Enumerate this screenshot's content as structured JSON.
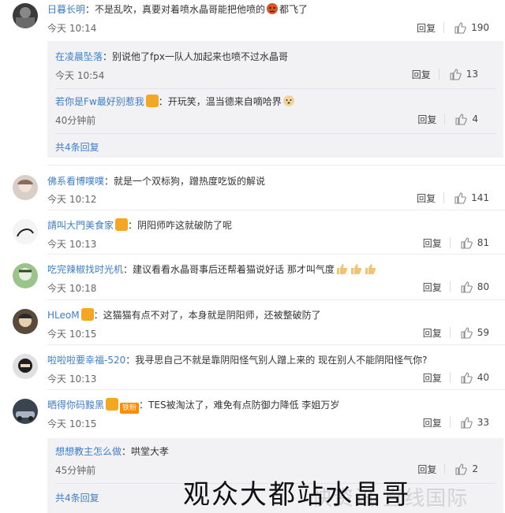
{
  "reply_label": "回复",
  "comments": [
    {
      "name": "日暮长明",
      "text": "不是乱吹，真要对着喷水晶哥能把他喷的",
      "text2": "都飞了",
      "time": "今天 10:14",
      "likes": "190"
    },
    {
      "name": "佛系看博噗噗",
      "text": "就是一个双标狗，蹭热度吃饭的解说",
      "time": "今天 10:12",
      "likes": "141"
    },
    {
      "name": "請叫大門美食家",
      "text": "阴阳师咋这就破防了呢",
      "time": "今天 10:13",
      "likes": "81"
    },
    {
      "name": "吃完辣椒找时光机",
      "text": "建议看看水晶哥事后还帮着猫说好话 那才叫气度",
      "time": "今天 10:18",
      "likes": "80"
    },
    {
      "name": "HLeoM",
      "text": "这猫猫有点不对了，本身就是阴阳师，还被整破防了",
      "time": "今天 10:15",
      "likes": "59"
    },
    {
      "name": "啦啦啦要幸福-520",
      "text": "我寻思自己不就是靠阴阳怪气别人蹭上来的 现在别人不能阴阳怪气你?",
      "time": "今天 10:13",
      "likes": "40"
    },
    {
      "name": "晒得你码黢黑",
      "fan_badge": "铁粉",
      "text": "TES被淘汰了，难免有点防御力降低 李姐万岁",
      "time": "今天 10:15",
      "likes": "33"
    }
  ],
  "replies_1": [
    {
      "name": "在凌晨坠落",
      "text": "别说他了fpx一队人加起来也喷不过水晶哥",
      "time": "今天 10:54",
      "likes": "13"
    },
    {
      "name": "若你是Fw最好别惹我",
      "text": "开玩笑，温当德来自嘀哈界",
      "time": "40分钟前",
      "likes": "4"
    }
  ],
  "replies_1_more": "共4条回复",
  "replies_7": [
    {
      "name": "想想教主怎么做",
      "text": "哄堂大孝",
      "time": "45分钟前",
      "likes": "2"
    }
  ],
  "replies_7_more": "共4条回复",
  "overlay_caption": "观众大都站水晶哥",
  "watermark": "快资讯 直线国际",
  "colors": {
    "link": "#3e7ec7",
    "sub_bg": "#f2f2f5",
    "divider": "#ececec"
  }
}
